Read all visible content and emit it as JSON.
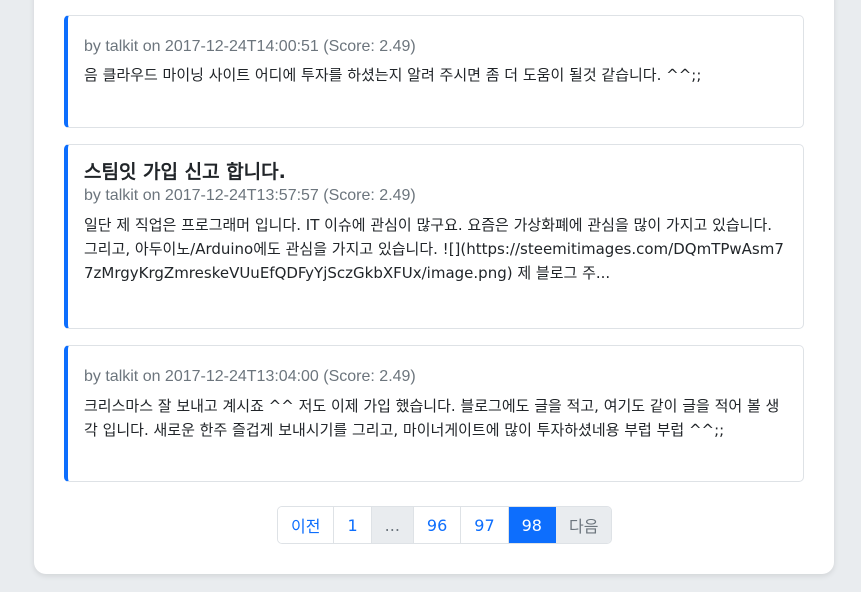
{
  "posts": [
    {
      "title": "",
      "meta": "by talkit on 2017-12-24T14:00:51 (Score: 2.49)",
      "excerpt": "음 클라우드 마이닝 사이트 어디에 투자를 하셨는지 알려 주시면 좀 더 도움이 될것 같습니다. ^^;;"
    },
    {
      "title": "스팀잇 가입 신고 합니다.",
      "meta": "by talkit on 2017-12-24T13:57:57 (Score: 2.49)",
      "excerpt": "일단 제 직업은 프로그래머 입니다. IT 이슈에 관심이 많구요. 요즘은 가상화폐에 관심을 많이 가지고 있습니다. 그리고, 아두이노/Arduino에도 관심을 가지고 있습니다. ![](https://steemitimages.com/DQmTPwAsm77zMrgyKrgZmreskeVUuEfQDFyYjSczGkbXFUx/image.png) 제 블로그 주..."
    },
    {
      "title": "",
      "meta": "by talkit on 2017-12-24T13:04:00 (Score: 2.49)",
      "excerpt": "크리스마스 잘 보내고 계시죠 ^^ 저도 이제 가입 했습니다. 블로그에도 글을 적고, 여기도 같이 글을 적어 볼 생각 입니다. 새로운 한주 즐겁게 보내시기를 그리고, 마이너게이트에 많이 투자하셨네용 부럽 부럽 ^^;;"
    }
  ],
  "pagination": {
    "prev": "이전",
    "first": "1",
    "ellipsis": "...",
    "p96": "96",
    "p97": "97",
    "current": "98",
    "next": "다음"
  },
  "colors": {
    "accent": "#0d6efd",
    "muted": "#6c757d"
  }
}
